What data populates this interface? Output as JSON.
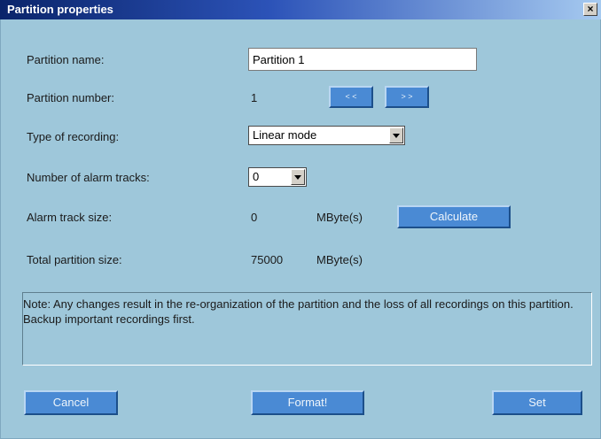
{
  "window": {
    "title": "Partition properties",
    "close_glyph": "×"
  },
  "form": {
    "partition_name_label": "Partition name:",
    "partition_name_value": "Partition 1",
    "partition_number_label": "Partition number:",
    "partition_number_value": "1",
    "prev_label": "< <",
    "next_label": "> >",
    "recording_type_label": "Type of recording:",
    "recording_type_value": "Linear mode",
    "alarm_tracks_label": "Number of alarm tracks:",
    "alarm_tracks_value": "0",
    "alarm_track_size_label": "Alarm track size:",
    "alarm_track_size_value": "0",
    "alarm_track_size_unit": "MByte(s)",
    "calculate_label": "Calculate",
    "total_size_label": "Total partition size:",
    "total_size_value": "75000",
    "total_size_unit": "MByte(s)"
  },
  "note": {
    "text": "Note: Any changes result in the re-organization of the partition and the loss of all recordings on this partition. Backup important recordings first."
  },
  "footer": {
    "cancel_label": "Cancel",
    "format_label": "Format!",
    "set_label": "Set"
  },
  "colors": {
    "background": "#9ec7da",
    "button": "#4a8ad4",
    "title_bar": "#0a246a"
  }
}
